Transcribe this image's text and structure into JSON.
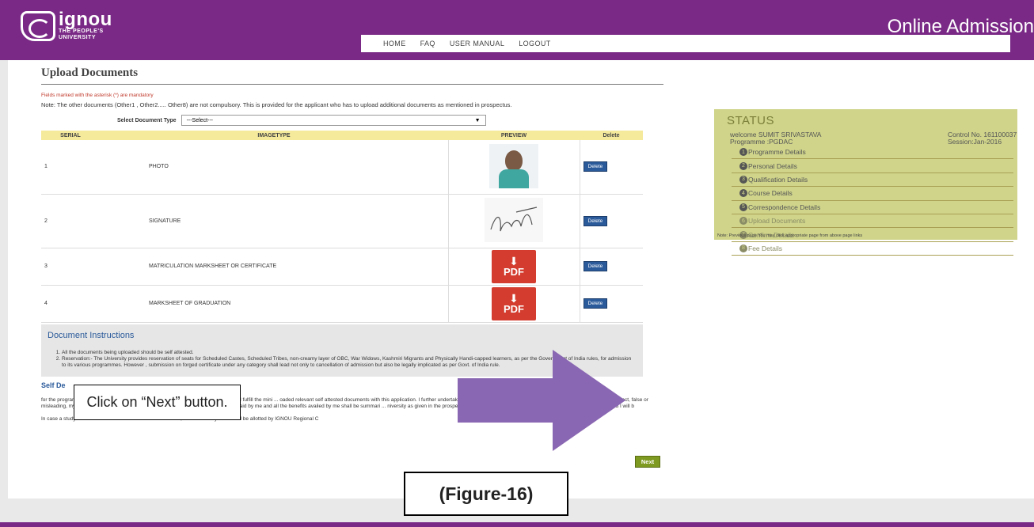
{
  "header": {
    "logo_name": "ignou",
    "logo_tagline_1": "THE PEOPLE'S",
    "logo_tagline_2": "UNIVERSITY",
    "title": "Online Admission",
    "nav": [
      "HOME",
      "FAQ",
      "USER MANUAL",
      "LOGOUT"
    ]
  },
  "page": {
    "heading": "Upload Documents",
    "mandatory_note": "Fields marked with the asterisk (*) are mandatory",
    "note": "Note: The other documents (Other1 , Other2..... Other8) are not compulsory. This is provided for the applicant who has to upload additional documents as mentioned in prospectus.",
    "select_label": "Select Document Type",
    "select_value": "---Select---"
  },
  "table": {
    "headers": [
      "SERIAL",
      "IMAGETYPE",
      "PREVIEW",
      "Delete"
    ],
    "rows": [
      {
        "serial": "1",
        "type": "PHOTO",
        "preview": "photo",
        "delete_label": "Delete"
      },
      {
        "serial": "2",
        "type": "SIGNATURE",
        "preview": "signature",
        "delete_label": "Delete"
      },
      {
        "serial": "3",
        "type": "MATRICULATION MARKSHEET OR CERTIFICATE",
        "preview": "pdf",
        "delete_label": "Delete"
      },
      {
        "serial": "4",
        "type": "MARKSHEET OF GRADUATION",
        "preview": "pdf",
        "delete_label": "Delete"
      }
    ],
    "pdf_label": "PDF"
  },
  "instructions": {
    "title": "Document Instructions",
    "items": [
      "All the documents being uploaded should be self attested.",
      "Reservation:- The University provides reservation of seats for Scheduled Castes, Scheduled Tribes, non-creamy layer of OBC, War Widows, Kashmiri Migrants and Physically Handi-capped learners, as per the Government of India rules, for admission to its various programmes. However , submission on forged certificate under any category shall lead not only to cancellation of admission but also be legally implicated as per Govt. of India rule."
    ]
  },
  "declaration": {
    "title": "Self De",
    "text": "for the programme for which I seek admission. To the best of my knowledge and belief, I fulfill the mini ... oaded relevant self attested documents with this application. I further undertake that I have not conceal ... self attested documents is found to be incorrect, false or misleading, my candidature shall be liable fo ... any nature including refund of any fee paid by me and all the benefits availed by me shall be summari ... niversity as given in the prospectus ... not raise any dispute over the ... thout advance information and I will b",
    "case_text": "In case a study centre cannot be allotted due to some reason, alternate study centre will be allotted by IGNOU Regional C"
  },
  "next_label": "Next",
  "status": {
    "title": "STATUS",
    "welcome": "welcome SUMIT SRIVASTAVA",
    "programme": "Programme :PGDAC",
    "control": "Control No. 161100037",
    "session": "Session:Jan-2016",
    "steps": [
      {
        "num": "1",
        "label": "Programme Details"
      },
      {
        "num": "2",
        "label": "Personal Details"
      },
      {
        "num": "3",
        "label": "Qualification Details"
      },
      {
        "num": "4",
        "label": "Course Details"
      },
      {
        "num": "5",
        "label": "Correspondence Details"
      },
      {
        "num": "6",
        "label": "Upload Documents"
      },
      {
        "num": "7",
        "label": "Confirm Details"
      },
      {
        "num": "8",
        "label": "Fee Details"
      }
    ],
    "footer": "Note: Previous page You may click appropriate page from above page links"
  },
  "callout": "Click on “Next” button.",
  "figure_label": "(Figure-16)",
  "colors": {
    "header_purple": "#7a2a86",
    "status_bg": "#cfd48a",
    "next_green": "#7f9a20",
    "delete_blue": "#2a5a9a",
    "arrow": "#8a67b2"
  }
}
